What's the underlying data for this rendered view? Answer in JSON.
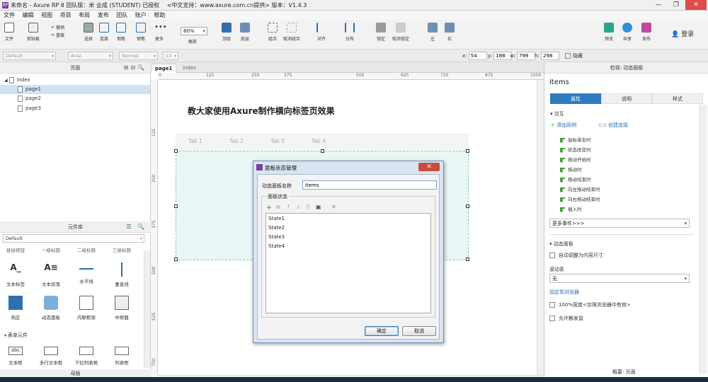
{
  "window": {
    "title": "未命名 - Axure RP 8 团队版：米 业成 (STUDENT) 已授权 　<中文支持：www.axure.com.cn提供> 版本：V1.4.3",
    "logo": "RP"
  },
  "menu": [
    "文件",
    "编辑",
    "视图",
    "项目",
    "布局",
    "发布",
    "团队",
    "账户",
    "帮助"
  ],
  "toolbar": {
    "file": "文件",
    "clipboard": "剪贴板",
    "undo": "撤销",
    "redo": "重做",
    "select": "选择",
    "connect": "连接",
    "crop": "钢笔",
    "more": "更多",
    "zoom_value": "80%",
    "zoom_label": "缩放",
    "top": "顶层",
    "bottom": "底层",
    "group": "组合",
    "ungroup": "取消组合",
    "align": "对齐",
    "distribute": "分布",
    "lock": "锁定",
    "unlock": "取消锁定",
    "left": "左",
    "right": "右",
    "preview": "预览",
    "share": "共享",
    "publish": "发布",
    "login": "登录"
  },
  "stylebar": {
    "style": "Default",
    "font": "Arial",
    "weight": "Normal",
    "size": "13",
    "x_label": "x:",
    "x": "54",
    "y_label": "y:",
    "y": "188",
    "w_label": "w:",
    "w": "798",
    "h_label": "h:",
    "h": "298",
    "hidden": "隐藏"
  },
  "pages_pane": {
    "title": "页面",
    "items": [
      {
        "label": "index"
      },
      {
        "label": "page1"
      },
      {
        "label": "page2"
      },
      {
        "label": "page3"
      }
    ]
  },
  "library_pane": {
    "title": "元件库",
    "library": "Default",
    "row0": [
      "链接按钮",
      "一级标题",
      "二级标题",
      "三级标题"
    ],
    "row1": [
      "文本标签",
      "文本段落",
      "水平线",
      "垂直线"
    ],
    "row2": [
      "热区",
      "动态面板",
      "内联框架",
      "中继器"
    ],
    "form_section": "表单元件",
    "row3": [
      "文本框",
      "多行文本框",
      "下拉列表框",
      "列表框"
    ],
    "masters": "母版"
  },
  "canvas": {
    "tabs": [
      "page1",
      "index"
    ],
    "ruler_h": [
      "0",
      "125",
      "250",
      "375",
      "500",
      "625",
      "750",
      "875",
      "1000"
    ],
    "ruler_v": [
      "125",
      "250",
      "375",
      "500",
      "625",
      "750"
    ],
    "heading": "教大家使用Axure制作横向标签页效果",
    "tab_labels": [
      "Tab 1",
      "Tab 2",
      "Tab 3",
      "Tab 4"
    ]
  },
  "dialog": {
    "title": "面板状态管理",
    "close": "✕",
    "name_label": "动态面板名称",
    "name_value": "items",
    "group_label": "面板状态",
    "states": [
      "State1",
      "State2",
      "State3",
      "State4"
    ],
    "ok": "确定",
    "cancel": "取消"
  },
  "inspector": {
    "title": "检视: 动态面板",
    "name": "items",
    "tabs": [
      "属性",
      "说明",
      "样式"
    ],
    "interaction": "交互",
    "add_case": "添加用例",
    "create_link": "创建连接",
    "events": [
      "鼠标单击时",
      "状态改变时",
      "拖动开始时",
      "拖动时",
      "拖动结束时",
      "向左拖动结束时",
      "向右拖动结束时",
      "载入时"
    ],
    "more_events": "更多事件>>>",
    "panel_section": "动态面板",
    "auto_fit": "自动调整为内容尺寸",
    "scrollbar_label": "滚动条",
    "scrollbar_value": "无",
    "pin": "固定到浏览器",
    "width100": "100%宽度<仅限浏览器中有效>",
    "allow_trigger": "允许触发鼠",
    "bottom_label": "概要: 页面"
  }
}
